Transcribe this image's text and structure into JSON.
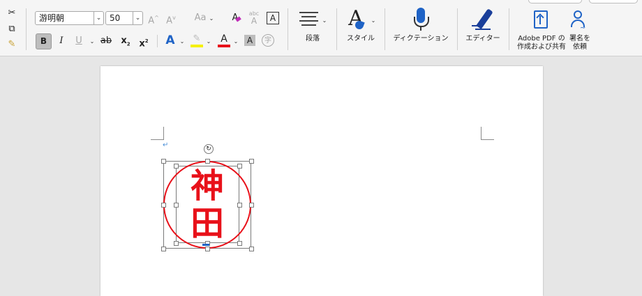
{
  "toolbar": {
    "font_name": "游明朝",
    "font_size": "50",
    "grow_font": "A",
    "shrink_font": "A",
    "change_case": "Aa",
    "clear_format": "A",
    "phonetic": "abc",
    "char_border": "A",
    "bold": "B",
    "italic": "I",
    "underline": "U",
    "strikethrough": "ab",
    "subscript": "x",
    "subscript_mark": "2",
    "superscript": "x",
    "superscript_mark": "2",
    "text_effects": "A",
    "font_color": "A",
    "char_shading": "A",
    "enclose_char": "字",
    "paragraph_label": "段落",
    "styles_label": "スタイル",
    "dictate_label": "ディクテーション",
    "editor_label": "エディター",
    "adobe_pdf_label_line1": "Adobe PDF の",
    "adobe_pdf_label_line2": "作成および共有",
    "signature_label_line1": "署名を",
    "signature_label_line2": "依頼"
  },
  "colors": {
    "accent_blue": "#1f63c6",
    "font_color_red": "#e8111a",
    "highlight_yellow": "#f5f000",
    "seal_red": "#e8111a"
  },
  "document": {
    "paragraph_mark": "↵",
    "seal_char_1": "神",
    "seal_char_2": "田"
  }
}
